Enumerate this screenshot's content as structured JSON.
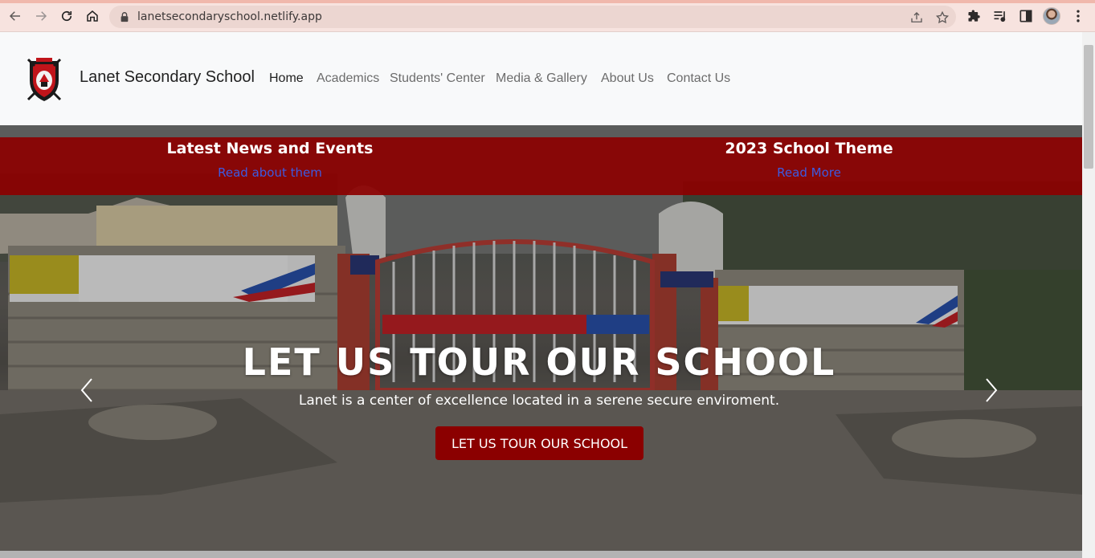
{
  "browser": {
    "url": "lanetsecondaryschool.netlify.app",
    "icons": {
      "back": "back-arrow-icon",
      "forward": "forward-arrow-icon",
      "reload": "reload-icon",
      "home": "home-icon",
      "lock": "lock-icon",
      "share": "share-icon",
      "bookmark": "star-icon",
      "extensions": "puzzle-icon",
      "media": "media-queue-icon",
      "sidepanel": "side-panel-icon",
      "menu": "kebab-menu-icon"
    }
  },
  "header": {
    "brand": "Lanet Secondary School",
    "nav": [
      {
        "label": "Home",
        "active": true
      },
      {
        "label": "Academics",
        "active": false
      },
      {
        "label": "Students' Center",
        "active": false
      },
      {
        "label": "Media & Gallery",
        "active": false
      },
      {
        "label": "About Us",
        "active": false
      },
      {
        "label": "Contact Us",
        "active": false
      }
    ]
  },
  "news_bar": {
    "items": [
      {
        "title": "Latest News and Events",
        "link": "Read about them"
      },
      {
        "title": "2023 School Theme",
        "link": "Read More"
      }
    ]
  },
  "hero": {
    "heading": "LET US TOUR OUR SCHOOL",
    "subtitle": "Lanet is a center of excellence located in a serene secure enviroment.",
    "button": "LET US TOUR OUR SCHOOL"
  },
  "colors": {
    "accent": "#8b0000",
    "link": "#3d5ae0",
    "header_bg": "#f8f9fa",
    "chrome_bg": "#f7e3df"
  }
}
